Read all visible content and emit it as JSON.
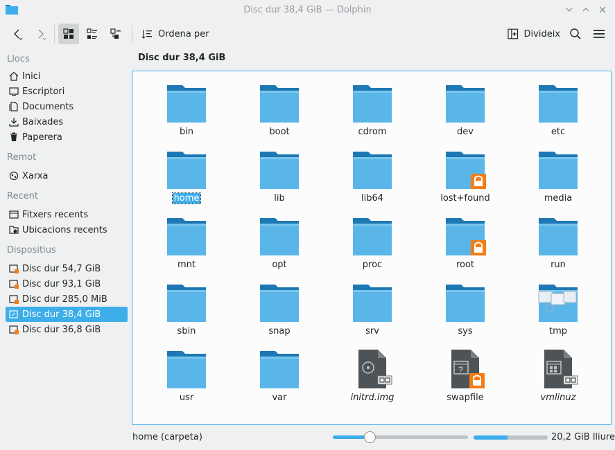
{
  "window": {
    "title": "Disc dur 38,4 GiB — Dolphin"
  },
  "toolbar": {
    "sort_label": "Ordena per",
    "split_label": "Divideix"
  },
  "location": "Disc dur 38,4 GiB",
  "sidebar": {
    "sections": [
      {
        "title": "Llocs",
        "items": [
          {
            "label": "Inici",
            "icon": "home-icon"
          },
          {
            "label": "Escriptori",
            "icon": "desktop-icon"
          },
          {
            "label": "Documents",
            "icon": "documents-icon"
          },
          {
            "label": "Baixades",
            "icon": "downloads-icon"
          },
          {
            "label": "Paperera",
            "icon": "trash-icon"
          }
        ]
      },
      {
        "title": "Remot",
        "items": [
          {
            "label": "Xarxa",
            "icon": "network-icon"
          }
        ]
      },
      {
        "title": "Recent",
        "items": [
          {
            "label": "Fitxers recents",
            "icon": "recent-files-icon"
          },
          {
            "label": "Ubicacions recents",
            "icon": "recent-locations-icon"
          }
        ]
      },
      {
        "title": "Dispositius",
        "items": [
          {
            "label": "Disc dur 54,7 GiB",
            "icon": "hard-disk-icon"
          },
          {
            "label": "Disc dur 93,1 GiB",
            "icon": "hard-disk-icon"
          },
          {
            "label": "Disc dur 285,0 MiB",
            "icon": "hard-disk-icon"
          },
          {
            "label": "Disc dur 38,4 GiB",
            "icon": "hard-disk-icon",
            "selected": true
          },
          {
            "label": "Disc dur 36,8 GiB",
            "icon": "hard-disk-icon"
          }
        ]
      }
    ]
  },
  "files": [
    {
      "name": "bin",
      "type": "folder"
    },
    {
      "name": "boot",
      "type": "folder"
    },
    {
      "name": "cdrom",
      "type": "folder"
    },
    {
      "name": "dev",
      "type": "folder"
    },
    {
      "name": "etc",
      "type": "folder"
    },
    {
      "name": "home",
      "type": "folder",
      "selected": true
    },
    {
      "name": "lib",
      "type": "folder"
    },
    {
      "name": "lib64",
      "type": "folder"
    },
    {
      "name": "lost+found",
      "type": "folder-locked"
    },
    {
      "name": "media",
      "type": "folder"
    },
    {
      "name": "mnt",
      "type": "folder"
    },
    {
      "name": "opt",
      "type": "folder"
    },
    {
      "name": "proc",
      "type": "folder"
    },
    {
      "name": "root",
      "type": "folder-locked"
    },
    {
      "name": "run",
      "type": "folder"
    },
    {
      "name": "sbin",
      "type": "folder"
    },
    {
      "name": "snap",
      "type": "folder"
    },
    {
      "name": "srv",
      "type": "folder"
    },
    {
      "name": "sys",
      "type": "folder"
    },
    {
      "name": "tmp",
      "type": "folder-tmp"
    },
    {
      "name": "usr",
      "type": "folder"
    },
    {
      "name": "var",
      "type": "folder"
    },
    {
      "name": "initrd.img",
      "type": "symlink-disc",
      "italic": true
    },
    {
      "name": "swapfile",
      "type": "file-locked"
    },
    {
      "name": "vmlinuz",
      "type": "symlink-exec",
      "italic": true
    }
  ],
  "status": {
    "text": "home (carpeta)",
    "zoom_fraction": 0.27,
    "free_space_text": "20,2 GiB lliure",
    "used_fraction": 0.46
  },
  "colors": {
    "accent": "#3daee9",
    "folder_light": "#5ab6e8",
    "folder_dark": "#1d78b4",
    "lock_badge": "#f47c14"
  }
}
